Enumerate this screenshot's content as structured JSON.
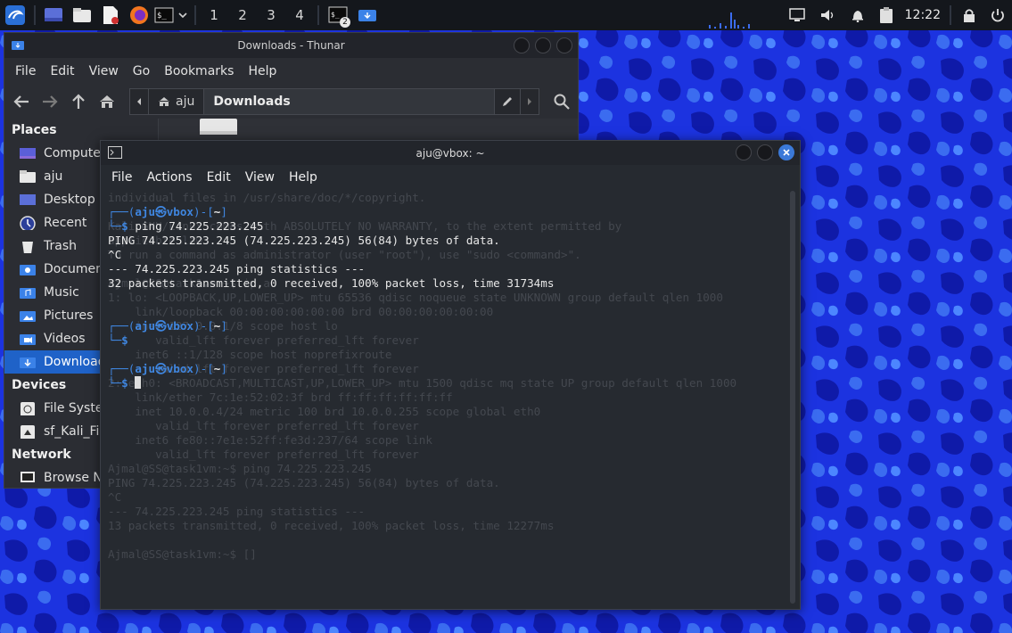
{
  "panel": {
    "workspaces": [
      "1",
      "2",
      "3",
      "4"
    ],
    "clock": "12:22",
    "terminal_badge": "2",
    "launchers": [
      "kali-menu-icon",
      "desktop-icon",
      "files-icon",
      "text-editor-icon",
      "firefox-icon",
      "terminal-icon"
    ]
  },
  "thunar": {
    "title": "Downloads - Thunar",
    "menu": [
      "File",
      "Edit",
      "View",
      "Go",
      "Bookmarks",
      "Help"
    ],
    "path": [
      "aju",
      "Downloads"
    ],
    "places_label": "Places",
    "places": [
      "Computer",
      "aju",
      "Desktop",
      "Recent",
      "Trash",
      "Documents",
      "Music",
      "Pictures",
      "Videos",
      "Downloads"
    ],
    "devices_label": "Devices",
    "devices": [
      "File System",
      "sf_Kali_Files"
    ],
    "network_label": "Network",
    "network": [
      "Browse Network"
    ]
  },
  "terminal": {
    "title": "aju@vbox: ~",
    "menu": [
      "File",
      "Actions",
      "Edit",
      "View",
      "Help"
    ],
    "lines": {
      "p1_user": "aju",
      "p1_host": "vbox",
      "p1_dir": "~",
      "cmd1": "ping 74.225.223.245",
      "out1": "PING 74.225.223.245 (74.225.223.245) 56(84) bytes of data.",
      "out2": "^C",
      "out3": "--- 74.225.223.245 ping statistics ---",
      "out4": "32 packets transmitted, 0 received, 100% packet loss, time 31734ms",
      "p2_user": "aju",
      "p2_host": "vbox",
      "p2_dir": "~",
      "p3_user": "aju",
      "p3_host": "vbox",
      "p3_dir": "~"
    },
    "ghost_text": [
      "individual files in /usr/share/doc/*/copyright.",
      "",
      "Kali GNU/Linux comes with ABSOLUTELY NO WARRANTY, to the extent permitted by",
      "applicable law.",
      "To run a command as administrator (user \"root\"), use \"sudo <command>\".",
      "",
      "Ajmal@SS@task1vm:~$ ip a",
      "1: lo: <LOOPBACK,UP,LOWER_UP> mtu 65536 qdisc noqueue state UNKNOWN group default qlen 1000",
      "    link/loopback 00:00:00:00:00:00 brd 00:00:00:00:00:00",
      "    inet 127.0.0.1/8 scope host lo",
      "       valid_lft forever preferred_lft forever",
      "    inet6 ::1/128 scope host noprefixroute",
      "       valid_lft forever preferred_lft forever",
      "2: eth0: <BROADCAST,MULTICAST,UP,LOWER_UP> mtu 1500 qdisc mq state UP group default qlen 1000",
      "    link/ether 7c:1e:52:02:3f brd ff:ff:ff:ff:ff:ff",
      "    inet 10.0.0.4/24 metric 100 brd 10.0.0.255 scope global eth0",
      "       valid_lft forever preferred_lft forever",
      "    inet6 fe80::7e1e:52ff:fe3d:237/64 scope link",
      "       valid_lft forever preferred_lft forever",
      "Ajmal@SS@task1vm:~$ ping 74.225.223.245",
      "PING 74.225.223.245 (74.225.223.245) 56(84) bytes of data.",
      "^C",
      "--- 74.225.223.245 ping statistics ---",
      "13 packets transmitted, 0 received, 100% packet loss, time 12277ms",
      "",
      "Ajmal@SS@task1vm:~$ []"
    ]
  },
  "colors": {
    "accent": "#1f62c8",
    "prompt_blue": "#3f86e0",
    "terminal_bg": "#262a30",
    "panel_bg": "#14171c"
  }
}
